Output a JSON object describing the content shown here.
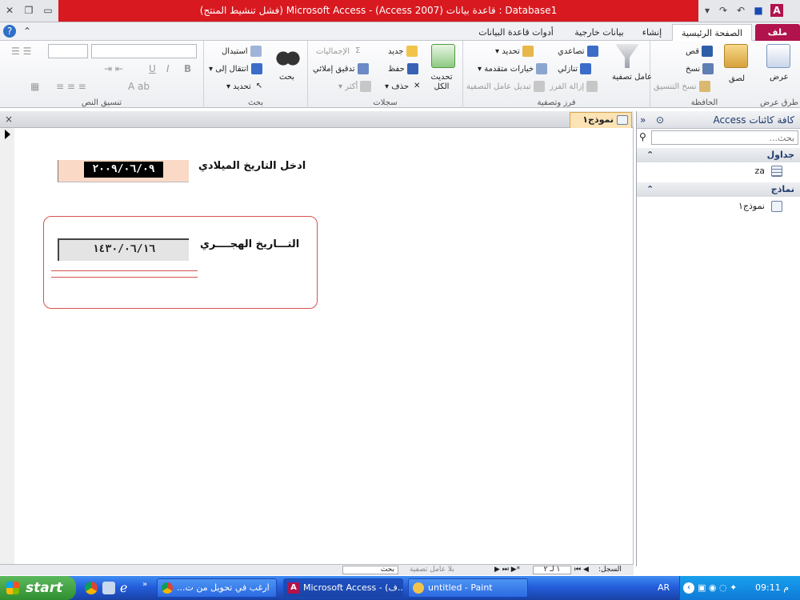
{
  "title": {
    "text": "(فشل تنشيط المنتج) Microsoft Access - (Access 2007) قاعدة بيانات : Database1"
  },
  "tabs": [
    {
      "label": "ملف"
    },
    {
      "label": "الصفحة الرئيسية"
    },
    {
      "label": "إنشاء"
    },
    {
      "label": "بيانات خارجية"
    },
    {
      "label": "أدوات قاعدة البيانات"
    }
  ],
  "ribbon": {
    "views": {
      "button": "عرض",
      "label": "طرق عرض"
    },
    "clipboard": {
      "paste": "لصق",
      "cut": "قص",
      "copy": "نسخ",
      "format_painter": "نسخ التنسيق",
      "label": "الحافظة"
    },
    "sort": {
      "filter": "عامل تصفية",
      "ascending": "تصاعدي",
      "descending": "تنازلي",
      "remove_sort": "إزالة الفرز",
      "selection": "تحديد",
      "advanced": "خيارات متقدمة",
      "toggle_filter": "تبديل عامل التصفية",
      "label": "فرز وتصفية"
    },
    "records": {
      "refresh": "تحديث الكل",
      "new": "جديد",
      "save": "حفظ",
      "delete": "حذف",
      "totals": "الإجماليات",
      "spelling": "تدقيق إملائي",
      "more": "أكثر",
      "label": "سجلات"
    },
    "find": {
      "find": "بحث",
      "replace": "استبدال",
      "goto": "انتقال إلى",
      "select": "تحديد",
      "label": "بحث"
    },
    "text": {
      "bold": "B",
      "italic": "I",
      "underline": "U",
      "label": "تنسيق النص"
    }
  },
  "nav": {
    "title": "كافة كائنات Access",
    "search_placeholder": "بحث...",
    "sections": [
      {
        "label": "جداول"
      },
      {
        "label": "نماذج"
      }
    ],
    "tables": [
      "za"
    ],
    "forms": [
      "نموذج١"
    ]
  },
  "doc": {
    "tab_label": "نموذج١",
    "close": "×"
  },
  "form": {
    "gregorian_label": "ادخل التاريخ الميلادي",
    "gregorian_value": "٢٠٠٩/٠٦/٠٩",
    "hijri_label": "التـــاريخ الهجــــري",
    "hijri_value": "١٤٣٠/٠٦/١٦"
  },
  "status": {
    "record_label": "السجل:",
    "record_value": "١ لـ ٢",
    "no_filter": "بلا عامل تصفية",
    "search": "بحث"
  },
  "taskbar": {
    "start": "start",
    "tasks": [
      "...ارغب في تحويل من ت",
      "Microsoft Access - (ف...",
      "untitled - Paint"
    ],
    "lang": "AR",
    "time": "09:11 م"
  },
  "colors": {
    "title_red": "#d81920",
    "file_tab": "#b1134c",
    "taskbar": "#245edb",
    "field_dark": "#000000"
  }
}
